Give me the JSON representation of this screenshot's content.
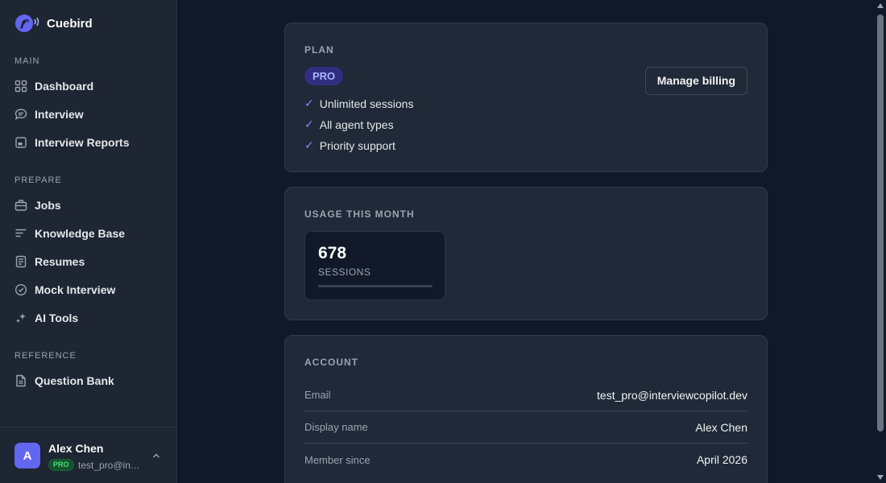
{
  "app": {
    "name": "Cuebird",
    "logo_icon": "bird-speaker-icon",
    "accent": "#6366f1"
  },
  "sidebar": {
    "sections": [
      {
        "label": "MAIN",
        "items": [
          {
            "label": "Dashboard",
            "icon": "grid-icon"
          },
          {
            "label": "Interview",
            "icon": "chat-bubble-icon"
          },
          {
            "label": "Interview Reports",
            "icon": "report-icon"
          }
        ]
      },
      {
        "label": "PREPARE",
        "items": [
          {
            "label": "Jobs",
            "icon": "briefcase-icon"
          },
          {
            "label": "Knowledge Base",
            "icon": "lines-icon"
          },
          {
            "label": "Resumes",
            "icon": "document-icon"
          },
          {
            "label": "Mock Interview",
            "icon": "check-circle-icon"
          },
          {
            "label": "AI Tools",
            "icon": "sparkle-icon"
          }
        ]
      },
      {
        "label": "REFERENCE",
        "items": [
          {
            "label": "Question Bank",
            "icon": "file-icon"
          }
        ]
      }
    ],
    "user": {
      "initial": "A",
      "name": "Alex Chen",
      "badge": "PRO",
      "email": "test_pro@interviewcopilot.dev"
    }
  },
  "plan": {
    "label": "PLAN",
    "tier": "PRO",
    "features": [
      "Unlimited sessions",
      "All agent types",
      "Priority support"
    ],
    "check_glyph": "✓",
    "manage_button": "Manage billing"
  },
  "usage": {
    "label": "USAGE THIS MONTH",
    "value": "678",
    "unit": "SESSIONS",
    "progress_fraction": 0
  },
  "account": {
    "label": "ACCOUNT",
    "rows": [
      {
        "key": "Email",
        "value": "test_pro@interviewcopilot.dev"
      },
      {
        "key": "Display name",
        "value": "Alex Chen"
      },
      {
        "key": "Member since",
        "value": "April 2026"
      }
    ]
  }
}
